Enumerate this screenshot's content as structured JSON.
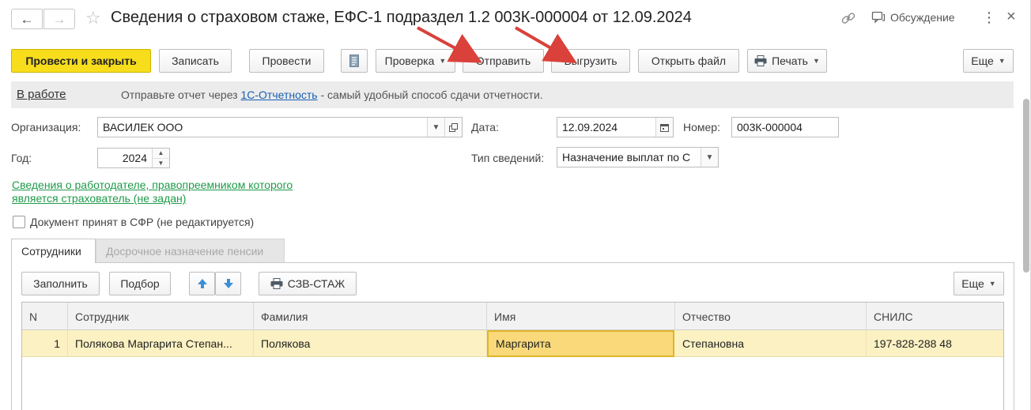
{
  "window": {
    "title": "Сведения о страховом стаже, ЕФС-1 подраздел 1.2 003К-000004 от 12.09.2024",
    "discuss_label": "Обсуждение",
    "icons": [
      "back-arrow-icon",
      "forward-arrow-icon",
      "star-icon",
      "link-icon",
      "chat-icon",
      "kebab-icon",
      "close-icon"
    ]
  },
  "toolbar": {
    "post_and_close": "Провести и закрыть",
    "save": "Записать",
    "post": "Провести",
    "check": "Проверка",
    "send": "Отправить",
    "export": "Выгрузить",
    "open_file": "Открыть файл",
    "print": "Печать",
    "more": "Еще"
  },
  "status": {
    "state": "В работе",
    "message_prefix": "Отправьте отчет через ",
    "message_link": "1С-Отчетность",
    "message_suffix": " - самый удобный способ сдачи отчетности."
  },
  "form": {
    "organization_label": "Организация:",
    "organization_value": "ВАСИЛЕК ООО",
    "date_label": "Дата:",
    "date_value": "12.09.2024",
    "number_label": "Номер:",
    "number_value": "003К-000004",
    "year_label": "Год:",
    "year_value": "2024",
    "info_type_label": "Тип сведений:",
    "info_type_value": "Назначение выплат по С",
    "successor_link": "Сведения о работодателе, правопреемником которого является страхователь (не задан)",
    "accepted_checkbox_label": "Документ принят в СФР (не редактируется)",
    "accepted_checked": false
  },
  "tabs": [
    {
      "label": "Сотрудники",
      "active": true
    },
    {
      "label": "Досрочное назначение пенсии",
      "active": false
    }
  ],
  "table_toolbar": {
    "fill": "Заполнить",
    "select": "Подбор",
    "szv": "СЗВ-СТАЖ",
    "more": "Еще"
  },
  "table": {
    "columns": [
      "N",
      "Сотрудник",
      "Фамилия",
      "Имя",
      "Отчество",
      "СНИЛС"
    ],
    "rows": [
      {
        "n": "1",
        "employee": "Полякова Маргарита Степан...",
        "last_name": "Полякова",
        "first_name": "Маргарита",
        "patronymic": "Степановна",
        "snils": "197-828-288 48"
      }
    ]
  },
  "colors": {
    "primary_button": "#f7dd1c",
    "link_green": "#1e9a4a",
    "link_blue": "#1a5fb4",
    "selected_row": "#fbf1c2",
    "annotation_arrow": "#d9413a"
  }
}
